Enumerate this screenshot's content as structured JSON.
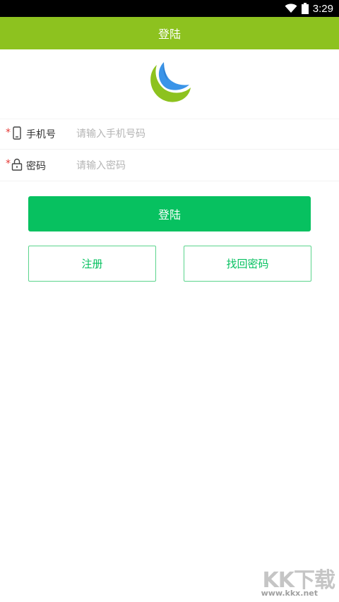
{
  "status_bar": {
    "time": "3:29",
    "icons": [
      "wifi-icon",
      "battery-icon"
    ]
  },
  "header": {
    "title": "登陆"
  },
  "form": {
    "phone": {
      "required_mark": "*",
      "icon": "phone-icon",
      "label": "手机号",
      "placeholder": "请输入手机号码",
      "value": ""
    },
    "password": {
      "required_mark": "*",
      "icon": "lock-icon",
      "label": "密码",
      "placeholder": "请输入密码",
      "value": ""
    }
  },
  "buttons": {
    "login": "登陆",
    "register": "注册",
    "recover": "找回密码"
  },
  "watermark": {
    "main": "KK下载",
    "url": "www.kkx.net"
  },
  "colors": {
    "header": "#8dc21f",
    "primary": "#07c160",
    "required": "#e53935",
    "logo_green": "#8dc21f",
    "logo_blue": "#3a94e8"
  }
}
